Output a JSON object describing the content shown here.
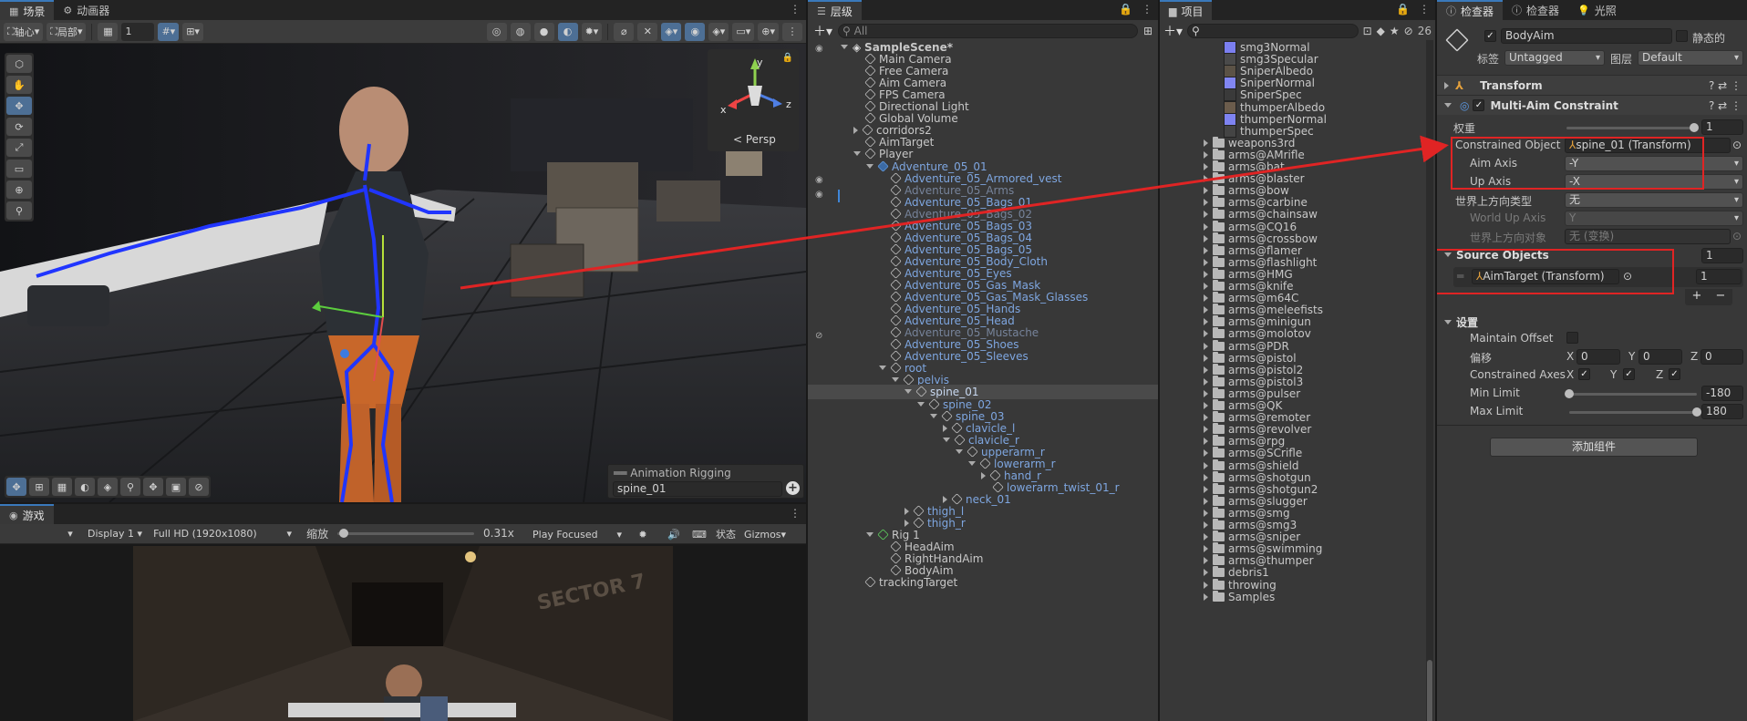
{
  "scene_panel": {
    "tabs": [
      "场景",
      "动画器"
    ],
    "pivot": "轴心",
    "space": "局部",
    "grid_value": "1",
    "persp_label": "< Persp",
    "gizmo_axes": [
      "y",
      "x",
      "z"
    ],
    "overlay": {
      "title": "Animation Rigging",
      "field": "spine_01"
    }
  },
  "game_panel": {
    "tab": "游戏",
    "display": "Display 1",
    "resolution": "Full HD (1920x1080)",
    "scale_label": "缩放",
    "scale_value": "0.31x",
    "play_mode": "Play Focused",
    "stats": "状态",
    "gizmos": "Gizmos",
    "wall_text": "SECTOR 7"
  },
  "hierarchy": {
    "tab": "层级",
    "search_placeholder": "All",
    "items": [
      {
        "label": "SampleScene*",
        "depth": 0,
        "arrow": "down",
        "icon": "scene",
        "style": "bold"
      },
      {
        "label": "Main Camera",
        "depth": 1,
        "arrow": "",
        "icon": "cube",
        "style": ""
      },
      {
        "label": "Free Camera",
        "depth": 1,
        "arrow": "",
        "icon": "cube",
        "style": ""
      },
      {
        "label": "Aim Camera",
        "depth": 1,
        "arrow": "",
        "icon": "cube",
        "style": ""
      },
      {
        "label": "FPS Camera",
        "depth": 1,
        "arrow": "",
        "icon": "cube",
        "style": ""
      },
      {
        "label": "Directional Light",
        "depth": 1,
        "arrow": "",
        "icon": "cube",
        "style": ""
      },
      {
        "label": "Global Volume",
        "depth": 1,
        "arrow": "",
        "icon": "cube",
        "style": ""
      },
      {
        "label": "corridors2",
        "depth": 1,
        "arrow": "right",
        "icon": "cube",
        "style": ""
      },
      {
        "label": "AimTarget",
        "depth": 1,
        "arrow": "",
        "icon": "cube",
        "style": ""
      },
      {
        "label": "Player",
        "depth": 1,
        "arrow": "down",
        "icon": "cube",
        "style": ""
      },
      {
        "label": "Adventure_05_01",
        "depth": 2,
        "arrow": "down",
        "icon": "bluecube",
        "style": "blue"
      },
      {
        "label": "Adventure_05_Armored_vest",
        "depth": 3,
        "arrow": "",
        "icon": "cube",
        "style": "blue"
      },
      {
        "label": "Adventure_05_Arms",
        "depth": 3,
        "arrow": "",
        "icon": "cube",
        "style": "dim"
      },
      {
        "label": "Adventure_05_Bags_01",
        "depth": 3,
        "arrow": "",
        "icon": "cube",
        "style": "blue"
      },
      {
        "label": "Adventure_05_Bags_02",
        "depth": 3,
        "arrow": "",
        "icon": "cube",
        "style": "dim"
      },
      {
        "label": "Adventure_05_Bags_03",
        "depth": 3,
        "arrow": "",
        "icon": "cube",
        "style": "blue"
      },
      {
        "label": "Adventure_05_Bags_04",
        "depth": 3,
        "arrow": "",
        "icon": "cube",
        "style": "blue"
      },
      {
        "label": "Adventure_05_Bags_05",
        "depth": 3,
        "arrow": "",
        "icon": "cube",
        "style": "blue"
      },
      {
        "label": "Adventure_05_Body_Cloth",
        "depth": 3,
        "arrow": "",
        "icon": "cube",
        "style": "blue"
      },
      {
        "label": "Adventure_05_Eyes",
        "depth": 3,
        "arrow": "",
        "icon": "cube",
        "style": "blue"
      },
      {
        "label": "Adventure_05_Gas_Mask",
        "depth": 3,
        "arrow": "",
        "icon": "cube",
        "style": "blue"
      },
      {
        "label": "Adventure_05_Gas_Mask_Glasses",
        "depth": 3,
        "arrow": "",
        "icon": "cube",
        "style": "blue"
      },
      {
        "label": "Adventure_05_Hands",
        "depth": 3,
        "arrow": "",
        "icon": "cube",
        "style": "blue"
      },
      {
        "label": "Adventure_05_Head",
        "depth": 3,
        "arrow": "",
        "icon": "cube",
        "style": "blue"
      },
      {
        "label": "Adventure_05_Mustache",
        "depth": 3,
        "arrow": "",
        "icon": "cube",
        "style": "dim"
      },
      {
        "label": "Adventure_05_Shoes",
        "depth": 3,
        "arrow": "",
        "icon": "cube",
        "style": "blue"
      },
      {
        "label": "Adventure_05_Sleeves",
        "depth": 3,
        "arrow": "",
        "icon": "cube",
        "style": "blue"
      },
      {
        "label": "root",
        "depth": 3,
        "arrow": "down",
        "icon": "cube",
        "style": "blue"
      },
      {
        "label": "pelvis",
        "depth": 4,
        "arrow": "down",
        "icon": "cube",
        "style": "blue"
      },
      {
        "label": "spine_01",
        "depth": 5,
        "arrow": "down",
        "icon": "cube",
        "style": "selected"
      },
      {
        "label": "spine_02",
        "depth": 6,
        "arrow": "down",
        "icon": "cube",
        "style": "blue"
      },
      {
        "label": "spine_03",
        "depth": 7,
        "arrow": "down",
        "icon": "cube",
        "style": "blue"
      },
      {
        "label": "clavicle_l",
        "depth": 8,
        "arrow": "right",
        "icon": "cube",
        "style": "blue"
      },
      {
        "label": "clavicle_r",
        "depth": 8,
        "arrow": "down",
        "icon": "cube",
        "style": "blue"
      },
      {
        "label": "upperarm_r",
        "depth": 9,
        "arrow": "down",
        "icon": "cube",
        "style": "blue"
      },
      {
        "label": "lowerarm_r",
        "depth": 10,
        "arrow": "down",
        "icon": "cube",
        "style": "blue"
      },
      {
        "label": "hand_r",
        "depth": 11,
        "arrow": "right",
        "icon": "cube",
        "style": "blue"
      },
      {
        "label": "lowerarm_twist_01_r",
        "depth": 11,
        "arrow": "",
        "icon": "cube",
        "style": "blue"
      },
      {
        "label": "neck_01",
        "depth": 8,
        "arrow": "right",
        "icon": "cube",
        "style": "blue"
      },
      {
        "label": "thigh_l",
        "depth": 5,
        "arrow": "right",
        "icon": "cube",
        "style": "blue"
      },
      {
        "label": "thigh_r",
        "depth": 5,
        "arrow": "right",
        "icon": "cube",
        "style": "blue"
      },
      {
        "label": "Rig 1",
        "depth": 2,
        "arrow": "down",
        "icon": "rig",
        "style": ""
      },
      {
        "label": "HeadAim",
        "depth": 3,
        "arrow": "",
        "icon": "cube",
        "style": ""
      },
      {
        "label": "RightHandAim",
        "depth": 3,
        "arrow": "",
        "icon": "cube",
        "style": ""
      },
      {
        "label": "BodyAim",
        "depth": 3,
        "arrow": "",
        "icon": "cube",
        "style": ""
      },
      {
        "label": "trackingTarget",
        "depth": 1,
        "arrow": "",
        "icon": "cube",
        "style": ""
      }
    ]
  },
  "project": {
    "tab": "项目",
    "count": "26",
    "items": [
      {
        "label": "smg3Normal",
        "type": "tex",
        "color": "#7b7ff0"
      },
      {
        "label": "smg3Specular",
        "type": "tex",
        "color": "#4a4a4a"
      },
      {
        "label": "SniperAlbedo",
        "type": "tex",
        "color": "#5b5246"
      },
      {
        "label": "SniperNormal",
        "type": "tex",
        "color": "#8186f2"
      },
      {
        "label": "SniperSpec",
        "type": "tex",
        "color": "#3a3a3a"
      },
      {
        "label": "thumperAlbedo",
        "type": "tex",
        "color": "#6b5c4c"
      },
      {
        "label": "thumperNormal",
        "type": "tex",
        "color": "#7e83f1"
      },
      {
        "label": "thumperSpec",
        "type": "tex",
        "color": "#444"
      },
      {
        "label": "weapons3rd",
        "type": "folder"
      },
      {
        "label": "arms@AMrifle",
        "type": "folder"
      },
      {
        "label": "arms@bat",
        "type": "folder"
      },
      {
        "label": "arms@blaster",
        "type": "folder"
      },
      {
        "label": "arms@bow",
        "type": "folder"
      },
      {
        "label": "arms@carbine",
        "type": "folder"
      },
      {
        "label": "arms@chainsaw",
        "type": "folder"
      },
      {
        "label": "arms@CQ16",
        "type": "folder"
      },
      {
        "label": "arms@crossbow",
        "type": "folder"
      },
      {
        "label": "arms@flamer",
        "type": "folder"
      },
      {
        "label": "arms@flashlight",
        "type": "folder"
      },
      {
        "label": "arms@HMG",
        "type": "folder"
      },
      {
        "label": "arms@knife",
        "type": "folder"
      },
      {
        "label": "arms@m64C",
        "type": "folder"
      },
      {
        "label": "arms@meleefists",
        "type": "folder"
      },
      {
        "label": "arms@minigun",
        "type": "folder"
      },
      {
        "label": "arms@molotov",
        "type": "folder"
      },
      {
        "label": "arms@PDR",
        "type": "folder"
      },
      {
        "label": "arms@pistol",
        "type": "folder"
      },
      {
        "label": "arms@pistol2",
        "type": "folder"
      },
      {
        "label": "arms@pistol3",
        "type": "folder"
      },
      {
        "label": "arms@pulser",
        "type": "folder"
      },
      {
        "label": "arms@QK",
        "type": "folder"
      },
      {
        "label": "arms@remoter",
        "type": "folder"
      },
      {
        "label": "arms@revolver",
        "type": "folder"
      },
      {
        "label": "arms@rpg",
        "type": "folder"
      },
      {
        "label": "arms@SCrifle",
        "type": "folder"
      },
      {
        "label": "arms@shield",
        "type": "folder"
      },
      {
        "label": "arms@shotgun",
        "type": "folder"
      },
      {
        "label": "arms@shotgun2",
        "type": "folder"
      },
      {
        "label": "arms@slugger",
        "type": "folder"
      },
      {
        "label": "arms@smg",
        "type": "folder"
      },
      {
        "label": "arms@smg3",
        "type": "folder"
      },
      {
        "label": "arms@sniper",
        "type": "folder"
      },
      {
        "label": "arms@swimming",
        "type": "folder"
      },
      {
        "label": "arms@thumper",
        "type": "folder"
      },
      {
        "label": "debris1",
        "type": "folder"
      },
      {
        "label": "throwing",
        "type": "folder"
      },
      {
        "label": "Samples",
        "type": "folder"
      }
    ]
  },
  "inspector": {
    "tabs": [
      "检查器",
      "检查器",
      "光照"
    ],
    "object_name": "BodyAim",
    "static_label": "静态的",
    "tag_label": "标签",
    "tag_value": "Untagged",
    "layer_label": "图层",
    "layer_value": "Default",
    "transform_title": "Transform",
    "constraint_title": "Multi-Aim Constraint",
    "weight_label": "权重",
    "weight_value": "1",
    "weight_fraction": 1.0,
    "constrained_object_label": "Constrained Object",
    "constrained_object_value": "spine_01 (Transform)",
    "aim_axis_label": "Aim Axis",
    "aim_axis_value": "-Y",
    "up_axis_label": "Up Axis",
    "up_axis_value": "-X",
    "world_up_type_label": "世界上方向类型",
    "world_up_type_value": "无",
    "world_up_axis_label": "World Up Axis",
    "world_up_axis_value": "Y",
    "world_up_object_label": "世界上方向对象",
    "world_up_object_value": "无 (变换)",
    "source_objects_label": "Source Objects",
    "source_objects_count": "1",
    "source_item_value": "AimTarget (Transform)",
    "source_item_weight": "1",
    "plus": "+",
    "minus": "−",
    "settings_label": "设置",
    "maintain_offset_label": "Maintain Offset",
    "offset_label": "偏移",
    "offset": {
      "x": "0",
      "y": "0",
      "z": "0"
    },
    "axis_letters": {
      "x": "X",
      "y": "Y",
      "z": "Z"
    },
    "constrained_axes_label": "Constrained Axes",
    "min_limit_label": "Min Limit",
    "min_limit_value": "-180",
    "min_limit_fraction": 0.0,
    "max_limit_label": "Max Limit",
    "max_limit_value": "180",
    "max_limit_fraction": 1.0,
    "add_component": "添加组件"
  }
}
